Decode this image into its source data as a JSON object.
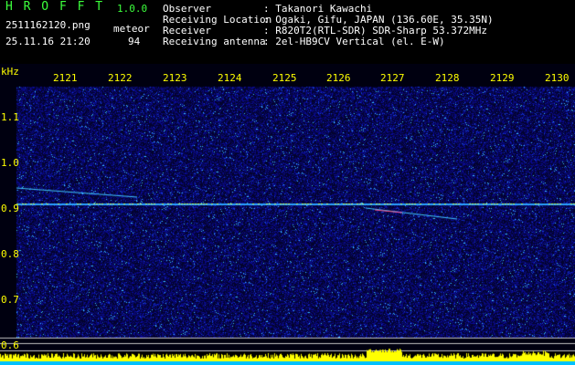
{
  "app": {
    "name": "H R O F F T",
    "version": "1.0.0"
  },
  "file": {
    "name": "2511162120.png",
    "datetime": "25.11.16 21:20"
  },
  "meteor": {
    "label": "meteor",
    "count": "94"
  },
  "info": {
    "observer_label": "Observer",
    "observer_value": ": Takanori Kawachi",
    "location_label": "Receiving Location",
    "location_value": ": Ogaki, Gifu, JAPAN (136.60E, 35.35N)",
    "receiver_label": "Receiver",
    "receiver_value": ": R820T2(RTL-SDR) SDR-Sharp 53.372MHz",
    "antenna_label": "Receiving antenna",
    "antenna_value": ": 2el-HB9CV Vertical (el. E-W)"
  },
  "colors": {
    "green": "#3cff3c",
    "yellow": "#ffff00",
    "background": "#000000",
    "noise": "#0a0a7a"
  },
  "axis": {
    "y_unit": "kHz",
    "y_ticks": [
      "1.1",
      "1.0",
      "0.9",
      "0.8",
      "0.7",
      "0.6"
    ],
    "x_ticks": [
      "2121",
      "2122",
      "2123",
      "2124",
      "2125",
      "2126",
      "2127",
      "2128",
      "2129",
      "2130"
    ]
  }
}
